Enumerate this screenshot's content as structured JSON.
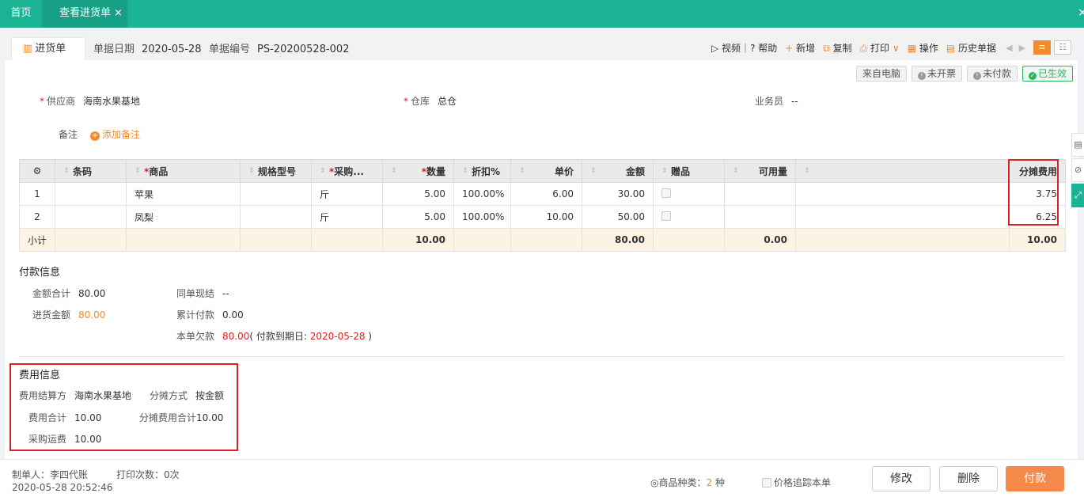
{
  "topbar": {
    "home_tab": "首页",
    "active_tab": "查看进货单",
    "close_glyph": "×"
  },
  "header": {
    "doc_tab": "进货单",
    "date_label": "单据日期",
    "date_value": "2020-05-28",
    "no_label": "单据编号",
    "no_value": "PS-20200528-002",
    "tools": {
      "video": "视频",
      "help": "帮助",
      "new": "新增",
      "copy": "复制",
      "print": "打印",
      "operate": "操作",
      "history": "历史单据"
    }
  },
  "badges": {
    "source": "来自电脑",
    "invoice": "未开票",
    "payment": "未付款",
    "status": "已生效"
  },
  "form": {
    "supplier_label": "供应商",
    "supplier_value": "海南水果基地",
    "warehouse_label": "仓库",
    "warehouse_value": "总仓",
    "salesman_label": "业务员",
    "salesman_value": "--",
    "note_label": "备注",
    "add_note": "添加备注"
  },
  "table": {
    "headers": {
      "barcode": "条码",
      "product": "商品",
      "spec": "规格型号",
      "unit": "采购...",
      "qty": "数量",
      "discount": "折扣%",
      "price": "单价",
      "amount": "金额",
      "gift": "赠品",
      "available": "可用量",
      "alloc": "分摊费用"
    },
    "rows": [
      {
        "no": "1",
        "product": "苹果",
        "unit": "斤",
        "qty": "5.00",
        "discount": "100.00%",
        "price": "6.00",
        "amount": "30.00",
        "alloc": "3.75"
      },
      {
        "no": "2",
        "product": "凤梨",
        "unit": "斤",
        "qty": "5.00",
        "discount": "100.00%",
        "price": "10.00",
        "amount": "50.00",
        "alloc": "6.25"
      }
    ],
    "subtotal": {
      "label": "小计",
      "qty": "10.00",
      "amount": "80.00",
      "available": "0.00",
      "alloc": "10.00"
    }
  },
  "payment": {
    "title": "付款信息",
    "total_label": "金额合计",
    "total_value": "80.00",
    "purchase_label": "进货金额",
    "purchase_value": "80.00",
    "cash_label": "同单现结",
    "cash_value": "--",
    "paid_label": "累计付款",
    "paid_value": "0.00",
    "owed_label": "本单欠款",
    "owed_value": "80.00",
    "due_prefix": "( 付款到期日: ",
    "due_date": "2020-05-28",
    "due_suffix": " )"
  },
  "fees": {
    "title": "费用信息",
    "payer_label": "费用结算方",
    "payer_value": "海南水果基地",
    "method_label": "分摊方式",
    "method_value": "按金额",
    "total_label": "费用合计",
    "total_value": "10.00",
    "alloc_label": "分摊费用合计",
    "alloc_value": "10.00",
    "freight_label": "采购运费",
    "freight_value": "10.00"
  },
  "footer": {
    "maker": "制单人：李四代账",
    "print_count": "打印次数：0次",
    "timestamp": "2020-05-28 20:52:46",
    "kinds_label": "商品种类：",
    "kinds_value": "2",
    "kinds_unit": "种",
    "price_track": "价格追踪本单",
    "edit": "修改",
    "delete": "删除",
    "pay": "付款"
  },
  "colors": {
    "teal": "#1ab394",
    "orange": "#f08c2f",
    "red": "#e02020",
    "green": "#2db35e"
  }
}
